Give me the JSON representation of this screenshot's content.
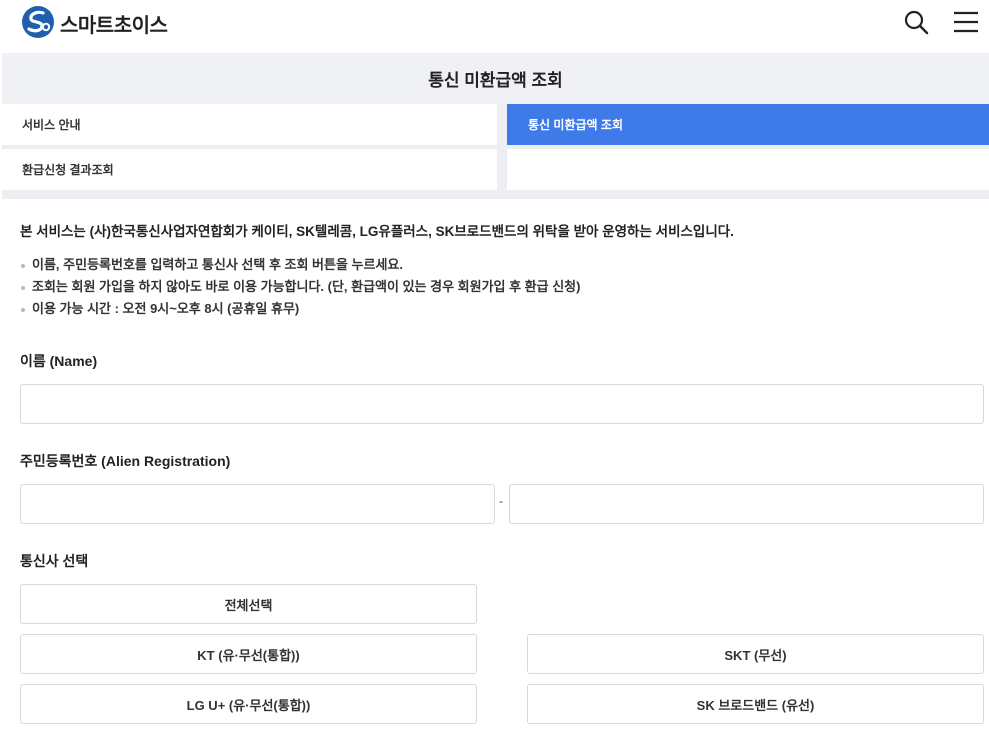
{
  "header": {
    "brand": "스마트초이스",
    "logo_icon": "smartchoice-logo-icon",
    "search_icon": "search-icon",
    "menu_icon": "hamburger-menu-icon",
    "brand_color": "#1f5fae"
  },
  "page": {
    "title": "통신 미환급액 조회"
  },
  "tabs": [
    {
      "label": "서비스 안내",
      "active": false
    },
    {
      "label": "통신 미환급액 조회",
      "active": true
    },
    {
      "label": "환급신청 결과조회",
      "active": false
    }
  ],
  "accent_color": "#3e7be8",
  "intro": "본 서비스는 (사)한국통신사업자연합회가 케이티, SK텔레콤, LG유플러스, SK브로드밴드의 위탁을 받아 운영하는 서비스입니다.",
  "notes": [
    "이름, 주민등록번호를 입력하고 통신사 선택 후 조회 버튼을 누르세요.",
    "조회는 회원 가입을 하지 않아도 바로 이용 가능합니다. (단, 환급액이 있는 경우 회원가입 후 환급 신청)",
    "이용 가능 시간 : 오전 9시~오후 8시 (공휴일 휴무)"
  ],
  "form": {
    "name_label": "이름 (Name)",
    "name_value": "",
    "reg_label": "주민등록번호 (Alien Registration)",
    "reg_front_value": "",
    "reg_separator": "-",
    "reg_back_value": "",
    "carrier_label": "통신사 선택",
    "select_all": "전체선택",
    "carriers": [
      "KT (유·무선(통합))",
      "SKT (무선)",
      "LG U+ (유·무선(통합))",
      "SK 브로드밴드 (유선)"
    ]
  }
}
